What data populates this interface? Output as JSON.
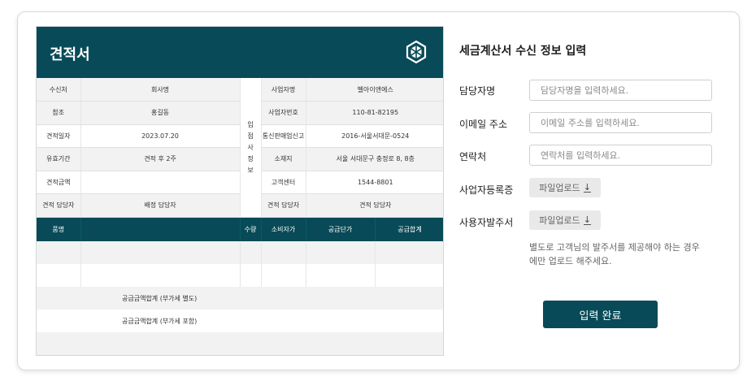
{
  "quote": {
    "title": "견적서",
    "info_rows": [
      {
        "label": "수신처",
        "value": "회사명",
        "right_label": "사업자명",
        "right_value": "벨아이앤에스"
      },
      {
        "label": "참조",
        "value": "홍길동",
        "right_label": "사업자번호",
        "right_value": "110-81-82195"
      },
      {
        "label": "견적일자",
        "value": "2023.07.20",
        "right_label": "통신판매업신고",
        "right_value": "2016-서울서대문-0524"
      },
      {
        "label": "유효기간",
        "value": "견적 후 2주",
        "right_label": "소재지",
        "right_value": "서울 서대문구 충정로 8, 8층"
      },
      {
        "label": "견적금액",
        "value": "",
        "right_label": "고객센터",
        "right_value": "1544-8801"
      },
      {
        "label": "견적 담당자",
        "value": "배정 담당자",
        "right_label": "견적 담당자",
        "right_value": "견적 담당자"
      }
    ],
    "vertical_label": [
      "입",
      "점",
      "사",
      "정",
      "보"
    ],
    "columns": {
      "item": "품명",
      "qty": "수량",
      "consumer_price": "소비자가",
      "unit_price": "공급단가",
      "total": "공급합계"
    },
    "sum_excl_vat": "공급금액합계 (부가세 별도)",
    "sum_incl_vat": "공급금액합계 (부가세 포함)"
  },
  "form": {
    "title": "세금계산서 수신 정보 입력",
    "manager": {
      "label": "담당자명",
      "placeholder": "담당자명을 입력하세요."
    },
    "email": {
      "label": "이메일 주소",
      "placeholder": "이메일 주소를 입력하세요."
    },
    "phone": {
      "label": "연락처",
      "placeholder": "연락처를 입력하세요."
    },
    "biz_reg": {
      "label": "사업자등록증",
      "button": "파일업로드",
      "icon": "download-icon"
    },
    "order_form": {
      "label": "사용자발주서",
      "button": "파일업로드",
      "icon": "download-icon"
    },
    "note": "별도로 고객님의 발주서를 제공해야 하는 경우에만 업로드 해주세요.",
    "submit": "입력 완료"
  },
  "colors": {
    "brand": "#084a57",
    "row_grey": "#f2f2f2",
    "upload_bg": "#e9e9e9"
  }
}
